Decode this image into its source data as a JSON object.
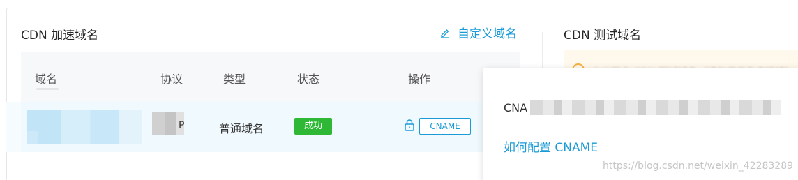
{
  "left_panel": {
    "title": "CDN 加速域名",
    "edit_link": "自定义域名",
    "columns": [
      "域名",
      "协议",
      "类型",
      "状态",
      "操作"
    ],
    "row": {
      "protocol_tail": "P",
      "type": "普通域名",
      "status": "成功",
      "action_button": "CNAME"
    }
  },
  "right_panel": {
    "title": "CDN 测试域名",
    "notice": "本公司会 CDN 测试域名（请勿用于生产环境）"
  },
  "popover": {
    "cname_prefix": "CNA",
    "help_link": "如何配置 CNAME"
  },
  "watermark": "https://blog.csdn.net/weixin_42283289",
  "colors": {
    "accent": "#1a9bd7",
    "success": "#2fb836",
    "warning": "#f5b142"
  }
}
